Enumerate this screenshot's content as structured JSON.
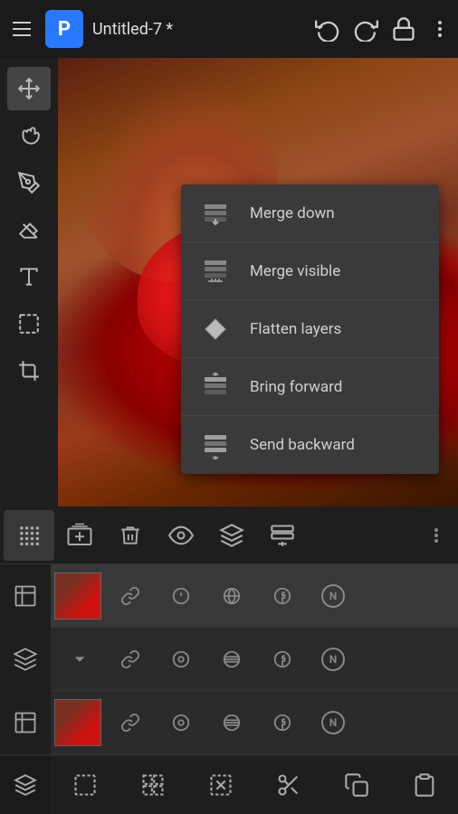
{
  "app": {
    "title": "Untitled-7 *",
    "logo": "P"
  },
  "topbar": {
    "undo_label": "undo",
    "redo_label": "redo",
    "lock_label": "lock",
    "more_label": "more"
  },
  "toolbar": {
    "tools": [
      {
        "name": "move",
        "icon": "✛"
      },
      {
        "name": "hand",
        "icon": "✋"
      },
      {
        "name": "brush",
        "icon": "✏"
      },
      {
        "name": "eraser",
        "icon": "◻"
      },
      {
        "name": "text",
        "icon": "T"
      },
      {
        "name": "select",
        "icon": "⬚"
      },
      {
        "name": "crop",
        "icon": "⊢"
      }
    ]
  },
  "context_menu": {
    "items": [
      {
        "id": "merge-down",
        "label": "Merge down"
      },
      {
        "id": "merge-visible",
        "label": "Merge visible"
      },
      {
        "id": "flatten-layers",
        "label": "Flatten layers"
      },
      {
        "id": "bring-forward",
        "label": "Bring forward"
      },
      {
        "id": "send-backward",
        "label": "Send backward"
      }
    ]
  },
  "layer_toolbar": {
    "add_layer": "add-layer",
    "delete_layer": "delete-layer",
    "hide_layer": "hide-layer",
    "layers": "layers",
    "merge": "merge",
    "more": "more"
  },
  "layers": [
    {
      "id": "layer-1",
      "has_thumb": true,
      "blend_mode": "N",
      "icons": [
        "link",
        "circle",
        "lines",
        "facebook",
        "N"
      ]
    },
    {
      "id": "layer-2",
      "has_thumb": false,
      "blend_mode": "N",
      "icons": [
        "chevron",
        "link",
        "circle",
        "lines",
        "facebook",
        "N"
      ]
    },
    {
      "id": "layer-3",
      "has_thumb": true,
      "blend_mode": "N",
      "icons": [
        "link",
        "circle",
        "lines",
        "facebook",
        "N"
      ]
    }
  ],
  "bottom_actions": {
    "icons": [
      "select-all",
      "grid",
      "deselect",
      "cut",
      "copy",
      "paste"
    ]
  },
  "colors": {
    "background": "#2a2a2a",
    "toolbar_bg": "#1e1e1e",
    "accent": "#2979ff",
    "text_primary": "#d0d0d0",
    "text_muted": "#888888",
    "menu_bg": "#3a3a3a",
    "selected_row": "#383838"
  }
}
